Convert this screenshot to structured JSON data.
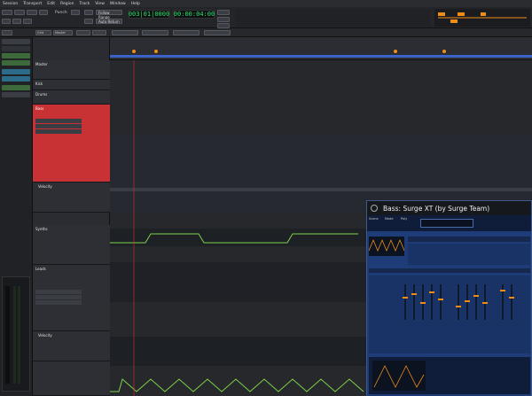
{
  "menu": [
    "Session",
    "Transport",
    "Edit",
    "Region",
    "Track",
    "View",
    "Window",
    "Help"
  ],
  "transport": {
    "punch_label": "Punch",
    "follow_range": "Follow Range",
    "clock_bbt": "003|01|0000",
    "clock_time": "00:00:04:00",
    "mode_label": "Auto Return"
  },
  "toolbar": {
    "grid_label": "Grid",
    "snap_label": "Master"
  },
  "tracks": [
    {
      "name": "Master",
      "color": "#2d2f34"
    },
    {
      "name": "Kick",
      "color": "#2d2f34"
    },
    {
      "name": "Drums",
      "color": "#2d2f34"
    },
    {
      "name": "Bass",
      "color": "#d9383a"
    },
    {
      "name": "Synths",
      "color": "#2d2f34"
    },
    {
      "name": "Leads",
      "color": "#2d2f34"
    }
  ],
  "automation_lanes": [
    {
      "label": "Velocity"
    },
    {
      "label": ""
    },
    {
      "label": "Velocity"
    }
  ],
  "bass_track_detail": {
    "slot1": "",
    "slot2": "",
    "slot3": ""
  },
  "leads_track_detail": {
    "slot1": "",
    "slot2": "",
    "slot3": ""
  },
  "plugin": {
    "title": "Bass: Surge XT (by Surge Team)",
    "patch_browser_label": "",
    "patch_name": "",
    "scene_labels": [
      "Scene",
      "Mode",
      "Poly"
    ],
    "section_labels": [
      "",
      "",
      "",
      ""
    ],
    "tabs": [
      "",
      "",
      "",
      ""
    ]
  },
  "sidebar": {
    "items": [
      "",
      "",
      "",
      "",
      "",
      "",
      "",
      ""
    ]
  },
  "colors": {
    "accent_orange": "#f08c18",
    "bass_red": "#d9383a",
    "green_line": "#7fd34a",
    "plugin_blue": "#1d3c78",
    "clock_green": "#2ee06a"
  }
}
